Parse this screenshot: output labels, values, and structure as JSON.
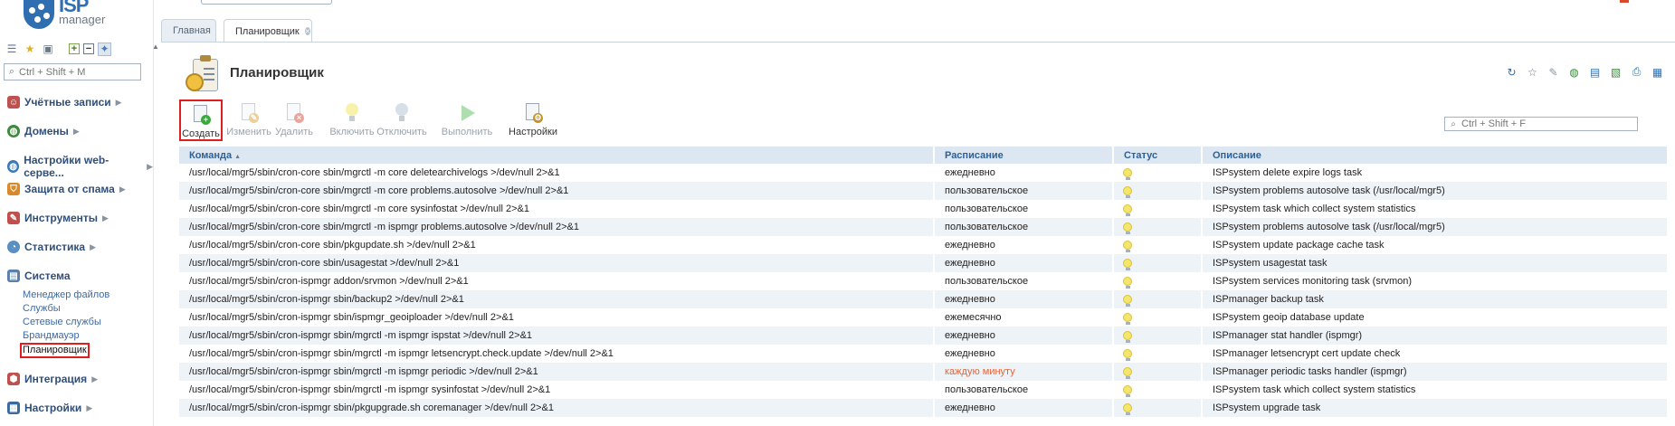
{
  "logo": {
    "title": "ISP",
    "subtitle": "manager"
  },
  "sidebar": {
    "search_placeholder": "Ctrl + Shift + M",
    "tool_icons": [
      "tree-icon",
      "star-icon",
      "bag-icon",
      "expand-all-icon",
      "collapse-all-icon",
      "pin-icon"
    ],
    "groups": [
      {
        "label": "Учётные записи",
        "icon": "user-icon",
        "color": "#c0504d"
      },
      {
        "label": "Домены",
        "icon": "globe-icon",
        "color": "#3d8a3d"
      },
      {
        "label": "Настройки web-серве...",
        "icon": "web-globe-icon",
        "color": "#3d7ab5"
      },
      {
        "label": "Защита от спама",
        "icon": "shield-icon",
        "color": "#d88a2a"
      },
      {
        "label": "Инструменты",
        "icon": "tools-icon",
        "color": "#c0504d"
      },
      {
        "label": "Статистика",
        "icon": "chart-icon",
        "color": "#5a8fc4"
      },
      {
        "label": "Система",
        "icon": "system-icon",
        "color": "#5a7fa8"
      },
      {
        "label": "Интеграция",
        "icon": "integration-icon",
        "color": "#c0504d"
      },
      {
        "label": "Настройки",
        "icon": "settings-icon",
        "color": "#3a6aa0"
      }
    ],
    "system_items": [
      "Менеджер файлов",
      "Службы",
      "Сетевые службы",
      "Брандмауэр",
      "Планировщик"
    ]
  },
  "tabs": [
    {
      "label": "Главная"
    },
    {
      "label": "Планировщик"
    }
  ],
  "page": {
    "title": "Планировщик"
  },
  "header_actions": [
    "refresh-icon",
    "favorite-icon",
    "pin-icon",
    "globe-icon",
    "document-icon",
    "export-icon",
    "print-icon",
    "settings-icon"
  ],
  "toolbar": {
    "create": "Создать",
    "edit": "Изменить",
    "delete": "Удалить",
    "enable": "Включить",
    "disable": "Отключить",
    "run": "Выполнить",
    "settings": "Настройки"
  },
  "table_search_placeholder": "Ctrl + Shift + F",
  "table": {
    "columns": [
      "Команда",
      "Расписание",
      "Статус",
      "Описание"
    ],
    "rows": [
      {
        "command": "/usr/local/mgr5/sbin/cron-core sbin/mgrctl -m core deletearchivelogs >/dev/null 2>&1",
        "schedule": "ежедневно",
        "description": "ISPsystem delete expire logs task"
      },
      {
        "command": "/usr/local/mgr5/sbin/cron-core sbin/mgrctl -m core problems.autosolve >/dev/null 2>&1",
        "schedule": "пользовательское",
        "description": "ISPsystem problems autosolve task (/usr/local/mgr5)"
      },
      {
        "command": "/usr/local/mgr5/sbin/cron-core sbin/mgrctl -m core sysinfostat >/dev/null 2>&1",
        "schedule": "пользовательское",
        "description": "ISPsystem task which collect system statistics"
      },
      {
        "command": "/usr/local/mgr5/sbin/cron-core sbin/mgrctl -m ispmgr problems.autosolve >/dev/null 2>&1",
        "schedule": "пользовательское",
        "description": "ISPsystem problems autosolve task (/usr/local/mgr5)"
      },
      {
        "command": "/usr/local/mgr5/sbin/cron-core sbin/pkgupdate.sh >/dev/null 2>&1",
        "schedule": "ежедневно",
        "description": "ISPsystem update package cache task"
      },
      {
        "command": "/usr/local/mgr5/sbin/cron-core sbin/usagestat >/dev/null 2>&1",
        "schedule": "ежедневно",
        "description": "ISPsystem usagestat task"
      },
      {
        "command": "/usr/local/mgr5/sbin/cron-ispmgr addon/srvmon >/dev/null 2>&1",
        "schedule": "пользовательское",
        "description": "ISPsystem services monitoring task (srvmon)"
      },
      {
        "command": "/usr/local/mgr5/sbin/cron-ispmgr sbin/backup2 >/dev/null 2>&1",
        "schedule": "ежедневно",
        "description": "ISPmanager backup task"
      },
      {
        "command": "/usr/local/mgr5/sbin/cron-ispmgr sbin/ispmgr_geoiploader >/dev/null 2>&1",
        "schedule": "ежемесячно",
        "description": "ISPsystem geoip database update"
      },
      {
        "command": "/usr/local/mgr5/sbin/cron-ispmgr sbin/mgrctl -m ispmgr ispstat >/dev/null 2>&1",
        "schedule": "ежедневно",
        "description": "ISPmanager stat handler (ispmgr)"
      },
      {
        "command": "/usr/local/mgr5/sbin/cron-ispmgr sbin/mgrctl -m ispmgr letsencrypt.check.update >/dev/null 2>&1",
        "schedule": "ежедневно",
        "description": "ISPmanager letsencrypt cert update check"
      },
      {
        "command": "/usr/local/mgr5/sbin/cron-ispmgr sbin/mgrctl -m ispmgr periodic >/dev/null 2>&1",
        "schedule": "каждую минуту",
        "accent": true,
        "description": "ISPmanager periodic tasks handler (ispmgr)"
      },
      {
        "command": "/usr/local/mgr5/sbin/cron-ispmgr sbin/mgrctl -m ispmgr sysinfostat >/dev/null 2>&1",
        "schedule": "пользовательское",
        "description": "ISPsystem task which collect system statistics"
      },
      {
        "command": "/usr/local/mgr5/sbin/cron-ispmgr sbin/pkgupgrade.sh coremanager >/dev/null 2>&1",
        "schedule": "ежедневно",
        "description": "ISPsystem upgrade task"
      }
    ]
  }
}
